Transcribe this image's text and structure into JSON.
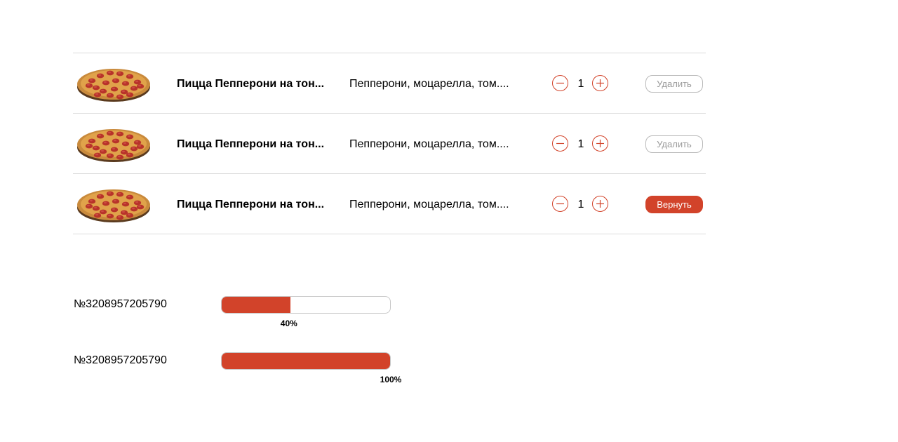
{
  "colors": {
    "accent": "#d2432a",
    "divider": "#dcdcdc",
    "muted_text": "#9a9a9a"
  },
  "cart": {
    "items": [
      {
        "image_icon": "pepperoni-pizza-image",
        "name": "Пицца Пепперони на тон...",
        "description": "Пепперони, моцарелла, том....",
        "quantity": "1",
        "action_label": "Удалить",
        "action_style": "outline"
      },
      {
        "image_icon": "pepperoni-pizza-image",
        "name": "Пицца Пепперони на тон...",
        "description": "Пепперони, моцарелла, том....",
        "quantity": "1",
        "action_label": "Удалить",
        "action_style": "outline"
      },
      {
        "image_icon": "pepperoni-pizza-image",
        "name": "Пицца Пепперони на тон...",
        "description": "Пепперони, моцарелла, том....",
        "quantity": "1",
        "action_label": "Вернуть",
        "action_style": "filled"
      }
    ]
  },
  "orders": [
    {
      "number": "№3208957205790",
      "progress": 0.4,
      "progress_label": "40%"
    },
    {
      "number": "№3208957205790",
      "progress": 1.0,
      "progress_label": "100%"
    }
  ]
}
